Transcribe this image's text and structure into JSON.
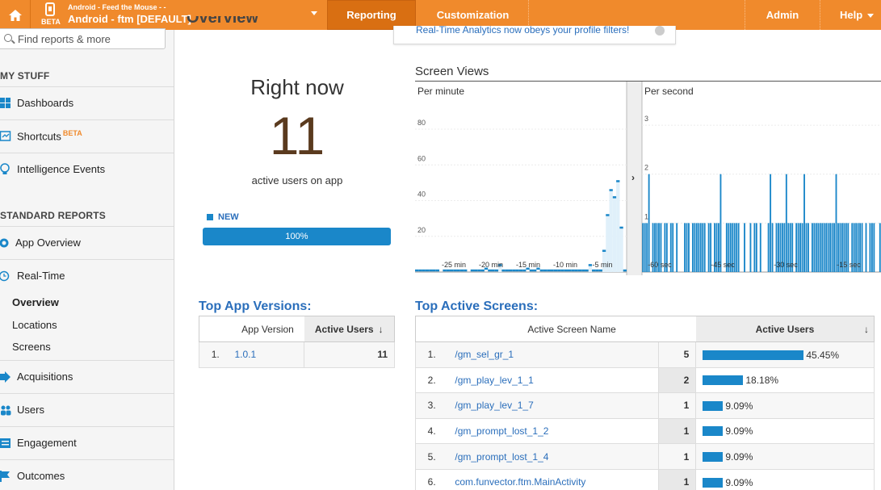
{
  "topbar": {
    "property_sub": "Android - Feed the Mouse - -",
    "property_main": "Android - ftm [DEFAULT]",
    "beta": "BETA",
    "tabs": {
      "reporting": "Reporting",
      "customization": "Customization",
      "admin": "Admin",
      "help": "Help"
    },
    "accent": "#f08a2c"
  },
  "sidebar": {
    "search_placeholder": "Find reports & more",
    "my_stuff": "MY STUFF",
    "dashboards": "Dashboards",
    "shortcuts": "Shortcuts",
    "shortcuts_beta": "BETA",
    "intelligence": "Intelligence Events",
    "standard_reports": "STANDARD REPORTS",
    "app_overview": "App Overview",
    "realtime": "Real-Time",
    "overview": "Overview",
    "locations": "Locations",
    "screens": "Screens",
    "acquisitions": "Acquisitions",
    "users": "Users",
    "engagement": "Engagement",
    "outcomes": "Outcomes"
  },
  "main": {
    "title": "Overview",
    "notice": "Real-Time Analytics now obeys your profile filters!",
    "right_now": "Right now",
    "active_count": "11",
    "active_label": "active users on app",
    "new_legend": "NEW",
    "new_percent": "100%",
    "new_fraction": 1.0
  },
  "chart_data": {
    "type": "bar",
    "title": "Screen Views",
    "panels": [
      {
        "name": "Per minute",
        "y_ticks": [
          20,
          40,
          60,
          80
        ],
        "ylim": [
          0,
          85
        ],
        "x_labels": [
          "-25 min",
          "-20 min",
          "-15 min",
          "-10 min",
          "-5 min"
        ],
        "values": [
          1,
          1,
          1,
          1,
          1,
          1,
          1,
          0,
          1,
          1,
          1,
          1,
          1,
          1,
          1,
          0,
          1,
          1,
          1,
          1,
          2,
          1,
          1,
          1,
          4,
          1,
          1,
          1,
          1,
          1,
          1,
          1,
          2,
          1,
          1,
          2,
          1,
          1,
          1,
          1,
          1,
          1,
          1,
          1,
          1,
          1,
          1,
          1,
          1,
          1,
          4,
          1,
          1,
          1,
          12,
          32,
          46,
          42,
          51,
          25,
          1
        ]
      },
      {
        "name": "Per second",
        "y_ticks": [
          1,
          2,
          3
        ],
        "ylim": [
          0,
          3.1
        ],
        "x_labels": [
          "-60 sec",
          "-45 sec",
          "-30 sec",
          "-15 sec"
        ],
        "values": [
          1,
          1,
          1,
          2,
          0,
          1,
          1,
          1,
          1,
          1,
          0,
          1,
          1,
          0,
          1,
          1,
          0,
          1,
          0,
          0,
          0,
          1,
          1,
          1,
          0,
          1,
          1,
          1,
          1,
          1,
          1,
          1,
          0,
          1,
          1,
          0,
          1,
          1,
          1,
          2,
          0,
          0,
          1,
          1,
          1,
          1,
          1,
          1,
          1,
          0,
          0,
          1,
          0,
          0,
          1,
          0,
          1,
          1,
          0,
          1,
          0,
          0,
          0,
          1,
          2,
          1,
          0,
          1,
          1,
          1,
          1,
          1,
          2,
          1,
          1,
          1,
          0,
          1,
          1,
          1,
          1,
          2,
          1,
          1,
          0,
          1,
          1,
          1,
          1,
          1,
          1,
          1,
          1,
          1,
          1,
          1,
          1,
          2,
          1,
          1,
          1,
          1,
          1,
          1,
          0,
          1,
          1,
          1,
          1,
          1,
          1,
          0,
          1,
          0,
          1,
          1,
          1,
          0,
          0,
          1
        ]
      }
    ]
  },
  "versions": {
    "title": "Top App Versions:",
    "headers": [
      "App Version",
      "Active Users"
    ],
    "rows": [
      {
        "rank": "1.",
        "name": "1.0.1",
        "value": "11"
      }
    ]
  },
  "screens": {
    "title": "Top Active Screens:",
    "headers": [
      "Active Screen Name",
      "Active Users"
    ],
    "rows": [
      {
        "rank": "1.",
        "name": "/gm_sel_gr_1",
        "value": "5",
        "pct": "45.45%",
        "fraction": 0.4545
      },
      {
        "rank": "2.",
        "name": "/gm_play_lev_1_1",
        "value": "2",
        "pct": "18.18%",
        "fraction": 0.1818
      },
      {
        "rank": "3.",
        "name": "/gm_play_lev_1_7",
        "value": "1",
        "pct": "9.09%",
        "fraction": 0.0909
      },
      {
        "rank": "4.",
        "name": "/gm_prompt_lost_1_2",
        "value": "1",
        "pct": "9.09%",
        "fraction": 0.0909
      },
      {
        "rank": "5.",
        "name": "/gm_prompt_lost_1_4",
        "value": "1",
        "pct": "9.09%",
        "fraction": 0.0909
      },
      {
        "rank": "6.",
        "name": "com.funvector.ftm.MainActivity",
        "value": "1",
        "pct": "9.09%",
        "fraction": 0.0909
      }
    ]
  }
}
